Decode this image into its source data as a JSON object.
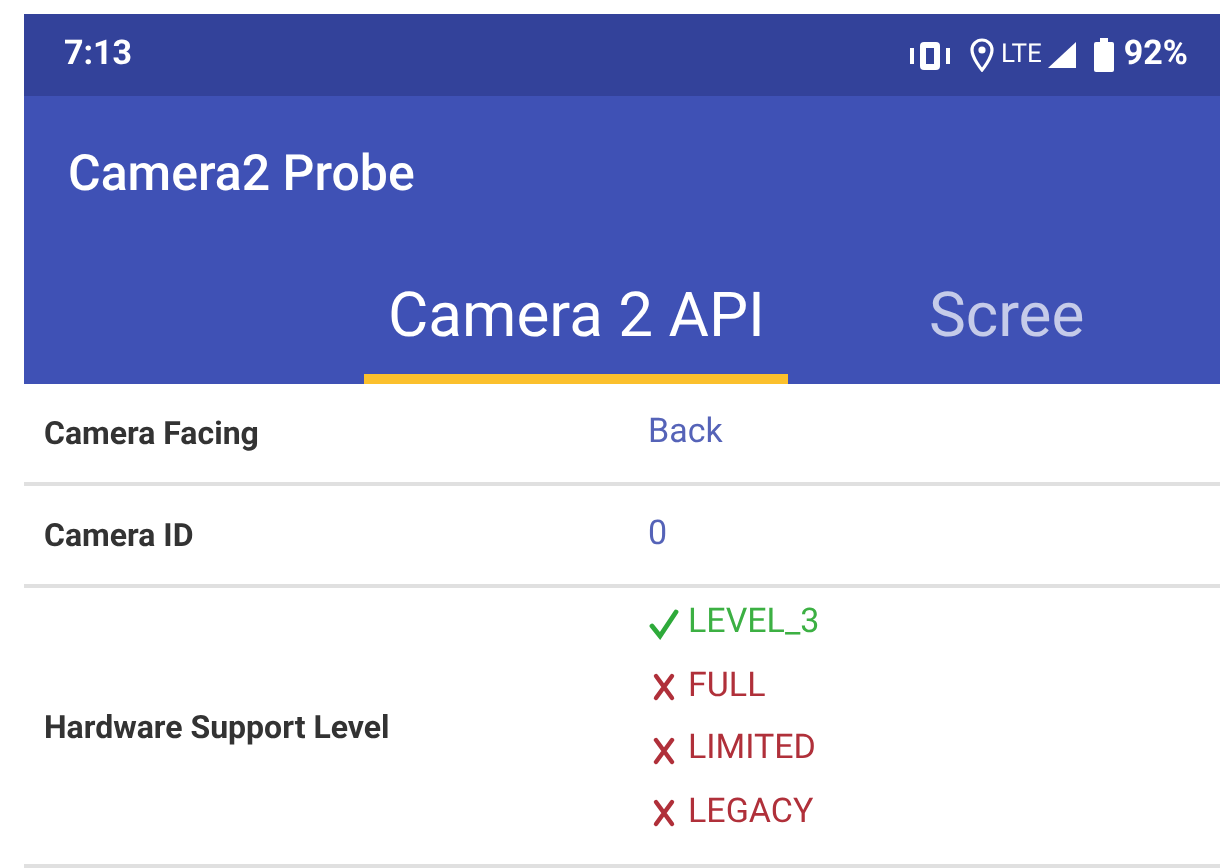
{
  "status_bar": {
    "time": "7:13",
    "network": "LTE",
    "battery": "92%"
  },
  "app_bar": {
    "title": "Camera2 Probe"
  },
  "tabs": [
    {
      "label": "Camera 2 API",
      "selected": true
    },
    {
      "label": "Scree",
      "selected": false
    }
  ],
  "rows": [
    {
      "label": "Camera Facing",
      "kind": "text",
      "value": "Back"
    },
    {
      "label": "Camera ID",
      "kind": "text",
      "value": "0"
    },
    {
      "label": "Hardware Support Level",
      "kind": "levels",
      "levels": [
        {
          "name": "LEVEL_3",
          "supported": true
        },
        {
          "name": "FULL",
          "supported": false
        },
        {
          "name": "LIMITED",
          "supported": false
        },
        {
          "name": "LEGACY",
          "supported": false
        }
      ]
    }
  ]
}
